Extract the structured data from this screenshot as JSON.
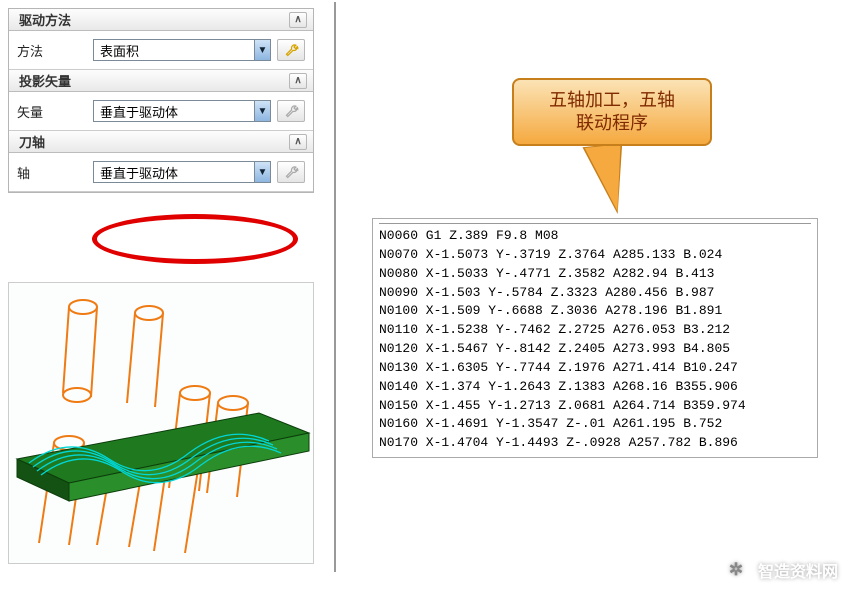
{
  "panel": {
    "sections": [
      {
        "title": "驱动方法",
        "label": "方法",
        "value": "表面积",
        "wrench": "active"
      },
      {
        "title": "投影矢量",
        "label": "矢量",
        "value": "垂直于驱动体",
        "wrench": "disabled"
      },
      {
        "title": "刀轴",
        "label": "轴",
        "value": "垂直于驱动体",
        "wrench": "disabled"
      }
    ]
  },
  "callout": {
    "line1": "五轴加工，五轴",
    "line2": "联动程序"
  },
  "gcode": [
    "N0060 G1 Z.389 F9.8 M08",
    "N0070 X-1.5073 Y-.3719 Z.3764 A285.133 B.024",
    "N0080 X-1.5033 Y-.4771 Z.3582 A282.94 B.413",
    "N0090 X-1.503 Y-.5784 Z.3323 A280.456 B.987",
    "N0100 X-1.509 Y-.6688 Z.3036 A278.196 B1.891",
    "N0110 X-1.5238 Y-.7462 Z.2725 A276.053 B3.212",
    "N0120 X-1.5467 Y-.8142 Z.2405 A273.993 B4.805",
    "N0130 X-1.6305 Y-.7744 Z.1976 A271.414 B10.247",
    "N0140 X-1.374 Y-1.2643 Z.1383 A268.16 B355.906",
    "N0150 X-1.455 Y-1.2713 Z.0681 A264.714 B359.974",
    "N0160 X-1.4691 Y-1.3547 Z-.01 A261.195 B.752",
    "N0170 X-1.4704 Y-1.4493 Z-.0928 A257.782 B.896"
  ],
  "watermark": "智造资料网"
}
